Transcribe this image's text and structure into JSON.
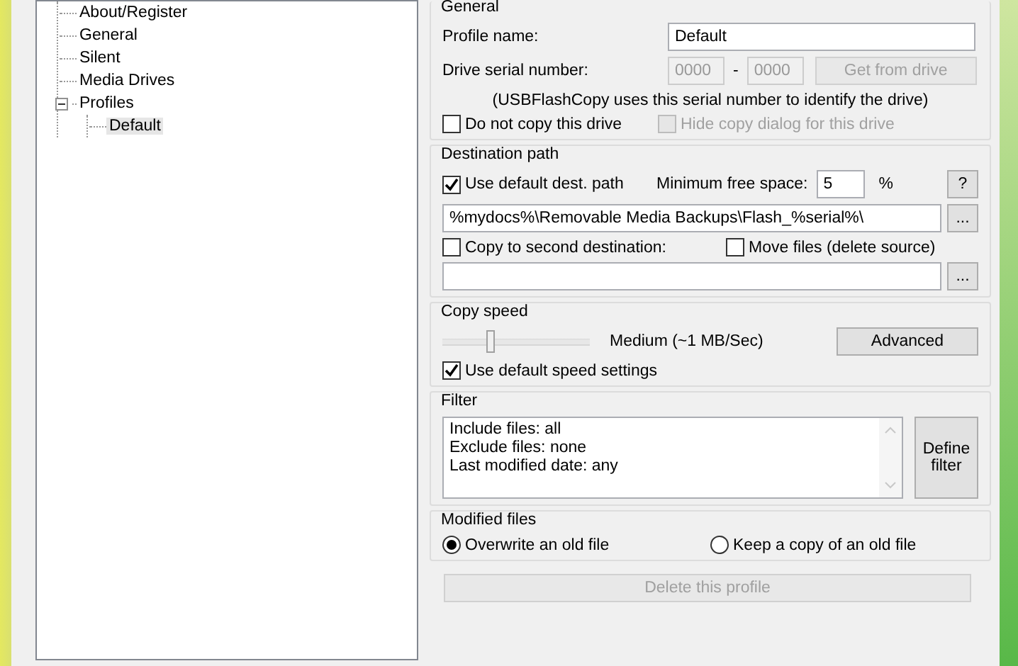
{
  "tree": [
    {
      "label": "About/Register",
      "selected": false
    },
    {
      "label": "General",
      "selected": false
    },
    {
      "label": "Silent",
      "selected": false
    },
    {
      "label": "Media Drives",
      "selected": false
    },
    {
      "label": "Profiles",
      "selected": false,
      "expanded": true,
      "children": [
        {
          "label": "Default",
          "selected": true
        }
      ]
    }
  ],
  "general": {
    "title": "General",
    "profile_name_label": "Profile name:",
    "profile_name": "Default",
    "serial_label": "Drive serial number:",
    "serial_1": "0000",
    "serial_separator": "-",
    "serial_2": "0000",
    "serial_disabled": true,
    "get_button": {
      "label": "Get from drive",
      "disabled": true
    },
    "note": "(USBFlashCopy uses this serial number to identify the drive)",
    "checkboxes": [
      {
        "label": "Do not copy this drive",
        "checked": false,
        "disabled": false
      },
      {
        "label": "Hide copy dialog for this drive",
        "checked": false,
        "disabled": true
      }
    ]
  },
  "destination": {
    "title": "Destination path",
    "use_default": {
      "label": "Use default dest. path",
      "checked": true,
      "disabled": false
    },
    "min_free_label": "Minimum free space:",
    "min_free_value": "5",
    "min_free_unit": "%",
    "help_button": "?",
    "path": "%mydocs%\\Removable Media Backups\\Flash_%serial%\\",
    "browse_button": "...",
    "second": {
      "label": "Copy to second destination:",
      "checked": false,
      "disabled": false
    },
    "move": {
      "label": "Move files (delete source)",
      "checked": false,
      "disabled": false
    },
    "second_browse_button": "..."
  },
  "copy_speed": {
    "title": "Copy speed",
    "level": 0.33,
    "reading": "Medium (~1 MB/Sec)",
    "advanced_button": "Advanced",
    "use_default": {
      "label": "Use default speed settings",
      "checked": true,
      "disabled": false
    }
  },
  "filter": {
    "title": "Filter",
    "lines": [
      "Include files: all",
      "Exclude files: none",
      "Last modified date: any"
    ],
    "define_button": "Define filter"
  },
  "modified_files": {
    "title": "Modified files",
    "options": [
      {
        "label": "Overwrite an old file",
        "selected": true
      },
      {
        "label": "Keep a copy of an old file",
        "selected": false
      }
    ]
  },
  "delete_button": {
    "label": "Delete this profile",
    "disabled": true
  }
}
